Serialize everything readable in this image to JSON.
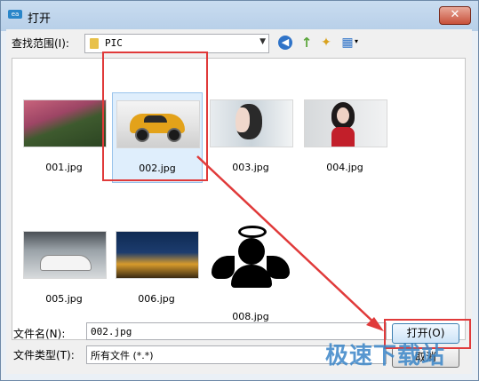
{
  "window": {
    "title": "打开",
    "close_glyph": "✕",
    "icon_text": "ea"
  },
  "toolbar": {
    "look_in_label": "查找范围(I):",
    "look_in_value": "PIC",
    "dropdown_glyph": "▼",
    "back_icon": "back-icon",
    "up_icon": "up-folder-icon",
    "new_folder_icon": "new-folder-icon",
    "view_icon": "view-menu-icon",
    "back_glyph": "◀",
    "up_glyph": "↑",
    "new_folder_glyph": "✦",
    "view_glyph": "▦",
    "view_arrow_glyph": "▾"
  },
  "files": [
    {
      "name": "001.jpg"
    },
    {
      "name": "002.jpg"
    },
    {
      "name": "003.jpg"
    },
    {
      "name": "004.jpg"
    },
    {
      "name": "005.jpg"
    },
    {
      "name": "006.jpg"
    },
    {
      "name": "008.jpg"
    }
  ],
  "selected_file": "002.jpg",
  "filename": {
    "label": "文件名(N):",
    "value": "002.jpg"
  },
  "filetype": {
    "label": "文件类型(T):",
    "value": "所有文件 (*.*)"
  },
  "buttons": {
    "open": "打开(O)",
    "cancel": "取消"
  },
  "watermark": "极速下载站",
  "colors": {
    "highlight": "#e03a3a",
    "selection": "#dfeefc",
    "accent": "#3b86c8"
  }
}
